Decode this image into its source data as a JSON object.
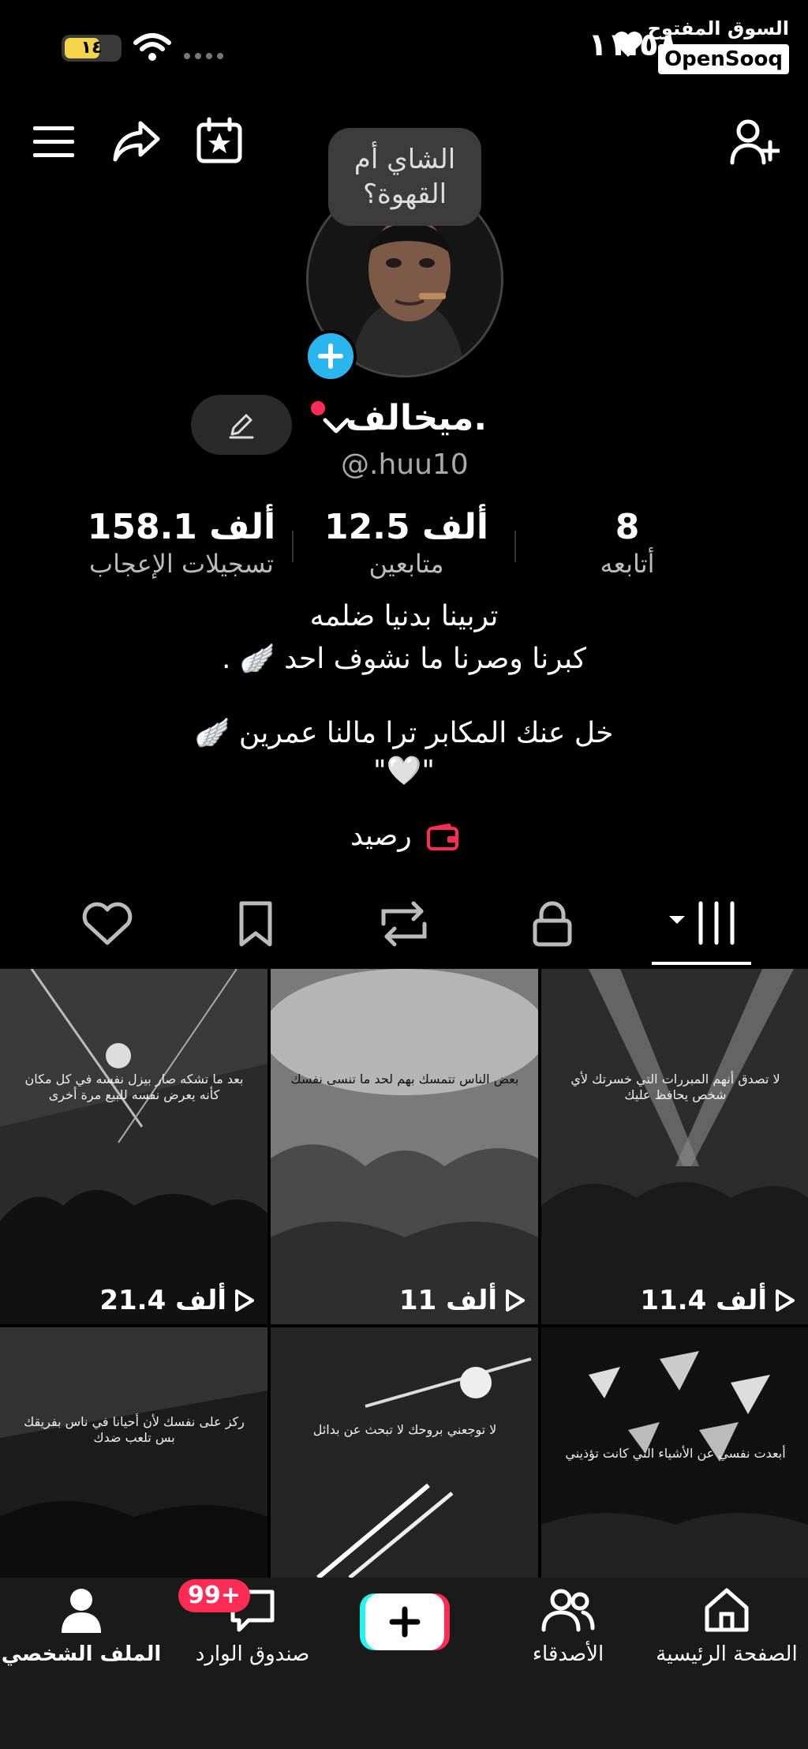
{
  "status": {
    "battery": "١٤",
    "time": "١١:٥٨"
  },
  "watermark": {
    "arabic": "السوق المفتوح",
    "brand": "OpenSooq"
  },
  "profile": {
    "bubble_text_line1": "الشاي أم",
    "bubble_text_line2": "القهوة؟",
    "name": "ميخالف.",
    "username": "@.huu10",
    "stats": [
      {
        "value": "158.1 ألف",
        "label": "تسجيلات الإعجاب"
      },
      {
        "value": "12.5 ألف",
        "label": "متابعين"
      },
      {
        "value": "8",
        "label": "أتابعه"
      }
    ],
    "bio": [
      "تربينا بدنيا ضلمه",
      "كبرنا وصرنا ما نشوف احد 🪽 .",
      "خل عنك المكابر ترا مالنا عمرين 🪽",
      "\"🤍\""
    ],
    "wallet_label": "رصيد"
  },
  "tabs": [
    "liked",
    "saved",
    "reposts",
    "private",
    "videos"
  ],
  "videos": [
    {
      "views": "21.4 ألف",
      "caption": "بعد ما تشكه صار بيزل نفسه في كل مكان كأنه يعرض نفسه للبيع مرة أخرى"
    },
    {
      "views": "11 ألف",
      "caption": "بعض الناس تتمسك بهم لحد ما تنسى نفسك"
    },
    {
      "views": "11.4 ألف",
      "caption": "لا تصدق أنهم المبررات التي خسرتك لأي شخص يحافظ عليك"
    },
    {
      "views": "",
      "caption": "ركز على نفسك لأن أحيانا في ناس بفريقك بس تلعب ضدك"
    },
    {
      "views": "",
      "caption": "لا توجعني بروحك لا تبحث عن بدائل"
    },
    {
      "views": "",
      "caption": "أبعدت نفسي عن الأشياء التي كانت تؤذيني"
    }
  ],
  "nav": {
    "home": "الصفحة الرئيسية",
    "friends": "الأصدقاء",
    "inbox": "صندوق الوارد",
    "inbox_badge": "99+",
    "profile": "الملف الشخصي"
  },
  "colors": {
    "accent_red": "#fe2c55",
    "accent_cyan": "#25f4ee",
    "add_blue": "#2bb5ee"
  }
}
